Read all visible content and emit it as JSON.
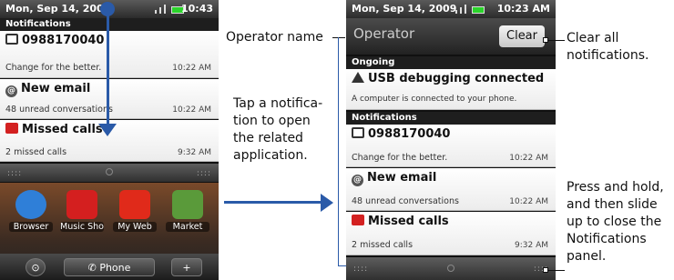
{
  "left_screen": {
    "status": {
      "date": "Mon, Sep 14, 2009",
      "time": "10:43"
    },
    "section_title": "Notifications",
    "notifications": [
      {
        "title": "0988170040",
        "text": "Change for the better.",
        "time": "10:22 AM",
        "icon": "sms-icon"
      },
      {
        "title": "New email",
        "text": "48 unread conversations",
        "time": "10:22 AM",
        "icon": "email-icon"
      },
      {
        "title": "Missed calls",
        "text": "2 missed calls",
        "time": "9:32 AM",
        "icon": "missed-call-icon"
      }
    ],
    "apps": [
      {
        "label": "Browser",
        "color": "#2f7fd8"
      },
      {
        "label": "Music Sho",
        "color": "#d41f1f"
      },
      {
        "label": "My Web",
        "color": "#e02a1a"
      },
      {
        "label": "Market",
        "color": "#5a9a3a"
      }
    ],
    "dock": {
      "phone_label": "Phone"
    }
  },
  "right_screen": {
    "status": {
      "date": "Mon, Sep 14, 2009",
      "time": "10:23 AM"
    },
    "operator": "Operator",
    "clear_label": "Clear",
    "ongoing_title": "Ongoing",
    "ongoing": {
      "title": "USB debugging connected",
      "text": "A computer is connected to your phone."
    },
    "section_title": "Notifications",
    "notifications": [
      {
        "title": "0988170040",
        "text": "Change for the better.",
        "time": "10:22 AM"
      },
      {
        "title": "New email",
        "text": "48 unread conversations",
        "time": "10:22 AM"
      },
      {
        "title": "Missed calls",
        "text": "2 missed calls",
        "time": "9:32 AM"
      }
    ]
  },
  "annotations": {
    "tap": [
      "Tap a notifica-",
      "tion to open",
      "the related",
      "application."
    ],
    "operator_name": "Operator name",
    "clear_all": [
      "Clear all",
      "notifications."
    ],
    "press_hold": [
      "Press and hold,",
      "and then slide",
      "up to close the",
      "Notifications",
      "panel."
    ]
  },
  "colors": {
    "accent_blue": "#2a5aa8"
  }
}
